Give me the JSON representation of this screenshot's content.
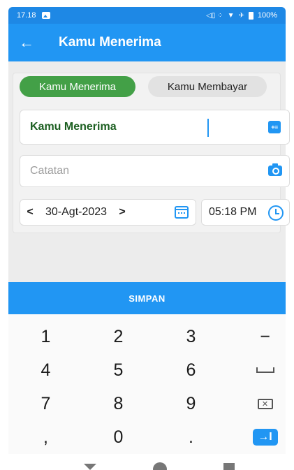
{
  "status_bar": {
    "time": "17.18",
    "battery": "100%",
    "signal": "◁▯ ⁘"
  },
  "app_bar": {
    "back_icon": "←",
    "title": "Kamu Menerima"
  },
  "type_toggle": {
    "selected_label": "Kamu Menerima",
    "other_label": "Kamu Membayar"
  },
  "amount_field": {
    "value": "Kamu Menerima",
    "calculator_icon": "calculator-icon",
    "calc_glyph": "+≡"
  },
  "note_field": {
    "placeholder": "Catatan",
    "camera_icon": "camera-icon"
  },
  "date_field": {
    "prev": "<",
    "date": "30-Agt-2023",
    "next": ">",
    "calendar_icon": "calendar-icon"
  },
  "time_field": {
    "time": "05:18 PM",
    "clock_icon": "clock-icon"
  },
  "save_button": {
    "label": "SIMPAN"
  },
  "keypad": {
    "rows": [
      [
        "1",
        "2",
        "3",
        "−"
      ],
      [
        "4",
        "5",
        "6",
        "space"
      ],
      [
        "7",
        "8",
        "9",
        "backspace"
      ],
      [
        ",",
        "0",
        ".",
        "enter"
      ]
    ],
    "backspace_glyph": "✕",
    "enter_glyph": "→I"
  },
  "colors": {
    "primary": "#2196f3",
    "accent_green": "#43a047",
    "amount_text": "#1b5e20"
  }
}
